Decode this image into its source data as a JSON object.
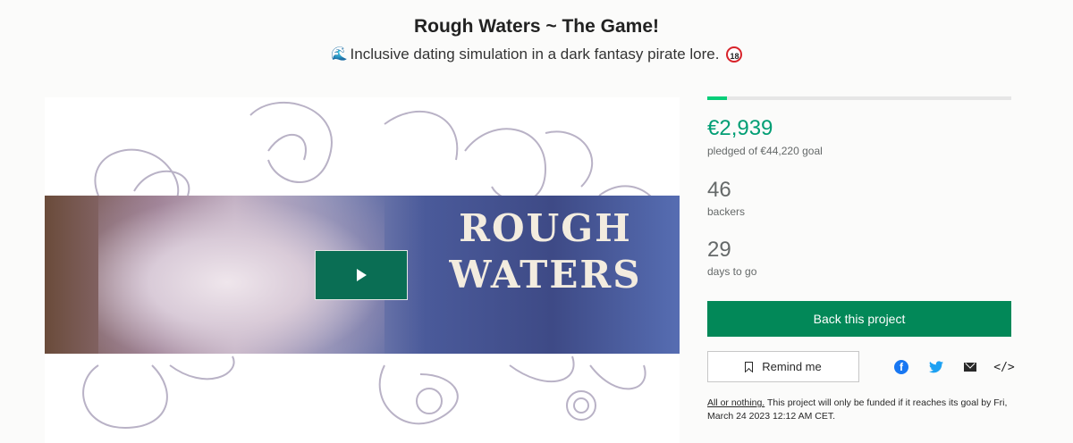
{
  "header": {
    "title": "Rough Waters ~ The Game!",
    "subtitle_icon_left": "wave-emoji",
    "subtitle": "Inclusive dating simulation in a dark fantasy pirate lore.",
    "subtitle_icon_right": "18-plus-emoji",
    "icon_right_text": "18"
  },
  "media": {
    "banner_line1": "ROUGH",
    "banner_line2": "WATERS",
    "play_icon": "play-icon"
  },
  "campaign": {
    "progress_fraction": 0.066,
    "pledged": "€2,939",
    "pledged_label": "pledged of €44,220 goal",
    "backers": "46",
    "backers_label": "backers",
    "days": "29",
    "days_label": "days to go"
  },
  "actions": {
    "back_label": "Back this project",
    "remind_label": "Remind me",
    "remind_icon": "bookmark-icon",
    "share_icons": [
      "facebook-icon",
      "twitter-icon",
      "mail-icon",
      "embed-icon"
    ],
    "facebook_glyph": "f",
    "twitter_glyph": "🐦",
    "embed_glyph": "</>"
  },
  "fine_print": {
    "link": "All or nothing.",
    "text": "This project will only be funded if it reaches its goal by Fri, March 24 2023 12:12 AM CET."
  },
  "colors": {
    "accent_green": "#028858",
    "pledged_green": "#009e74",
    "progress_green": "#05ce78"
  }
}
